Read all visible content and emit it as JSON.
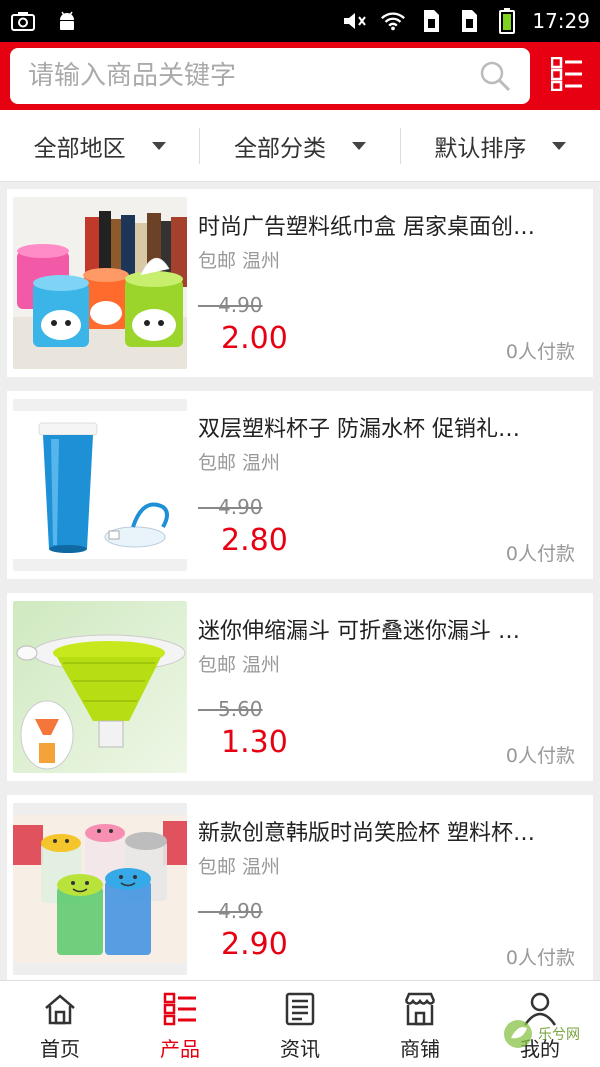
{
  "status_bar": {
    "time": "17:29"
  },
  "search": {
    "placeholder": "请输入商品关键字"
  },
  "filters": [
    {
      "label": "全部地区"
    },
    {
      "label": "全部分类"
    },
    {
      "label": "默认排序"
    }
  ],
  "products": [
    {
      "title": "时尚广告塑料纸巾盒 居家桌面创…",
      "tag": "包邮 温州",
      "old_price": "4.90",
      "old_prefix": "—",
      "price": "2.00",
      "sold": "0人付款"
    },
    {
      "title": "双层塑料杯子 防漏水杯 促销礼…",
      "tag": "包邮 温州",
      "old_price": "4.90",
      "old_prefix": "—",
      "price": "2.80",
      "sold": "0人付款"
    },
    {
      "title": "迷你伸缩漏斗 可折叠迷你漏斗 …",
      "tag": "包邮 温州",
      "old_price": "5.60",
      "old_prefix": "—",
      "price": "1.30",
      "sold": "0人付款"
    },
    {
      "title": "新款创意韩版时尚笑脸杯 塑料杯…",
      "tag": "包邮 温州",
      "old_price": "4.90",
      "old_prefix": "—",
      "price": "2.90",
      "sold": "0人付款"
    }
  ],
  "tabs": [
    {
      "label": "首页",
      "icon": "home-icon"
    },
    {
      "label": "产品",
      "icon": "list-icon"
    },
    {
      "label": "资讯",
      "icon": "news-icon"
    },
    {
      "label": "商铺",
      "icon": "shop-icon"
    },
    {
      "label": "我的",
      "icon": "user-icon"
    }
  ],
  "watermark": {
    "text": "乐兮网"
  },
  "colors": {
    "brand": "#e60012",
    "price": "#e60012"
  }
}
